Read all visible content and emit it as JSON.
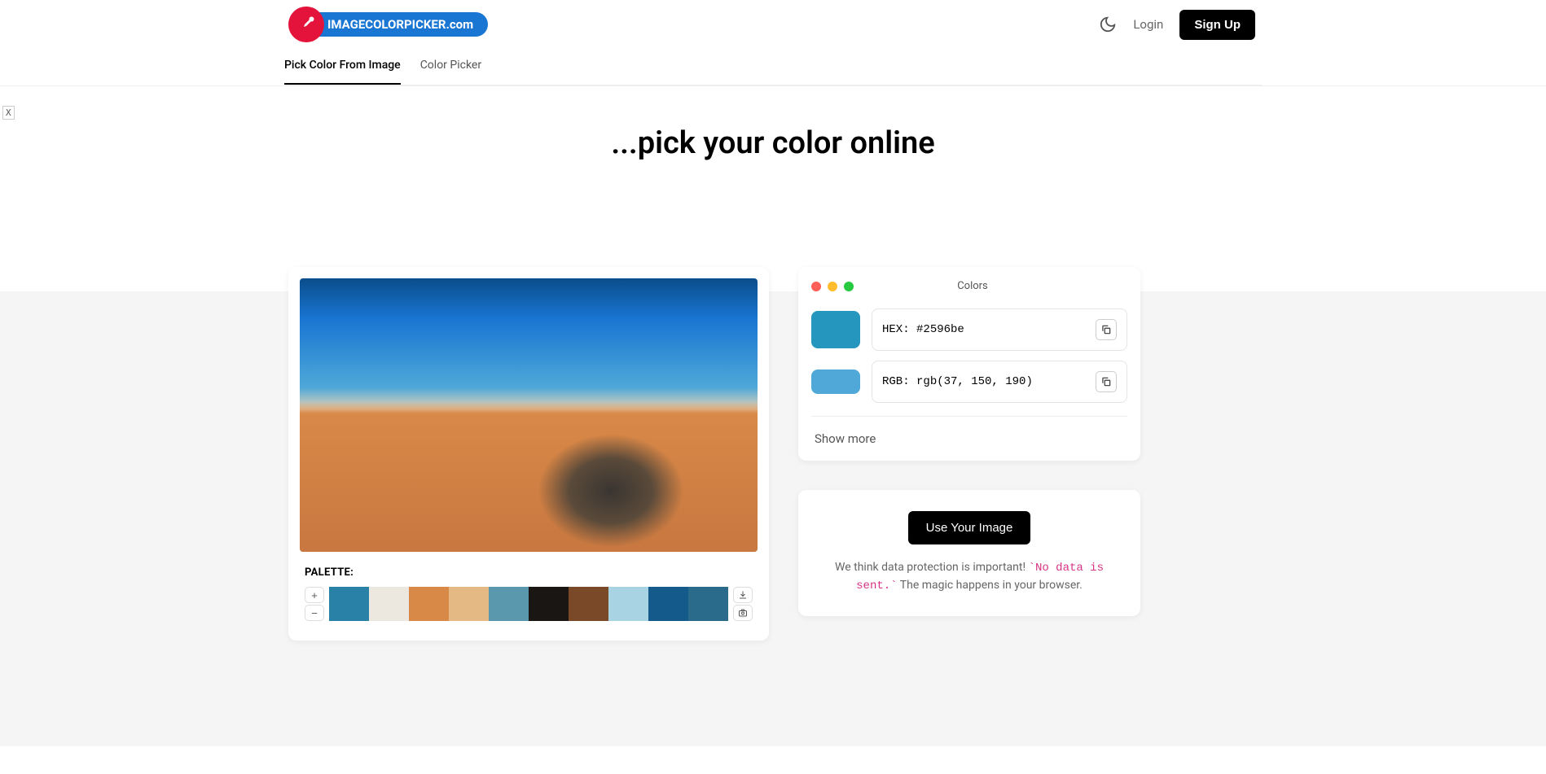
{
  "header": {
    "brand": "IMAGECOLORPICKER.com",
    "login": "Login",
    "signup": "Sign Up"
  },
  "nav": {
    "tabs": [
      {
        "label": "Pick Color From Image",
        "active": true
      },
      {
        "label": "Color Picker",
        "active": false
      }
    ]
  },
  "closeX": "X",
  "hero": {
    "title": "...pick your color online"
  },
  "colors_card": {
    "title": "Colors",
    "hex_label": "HEX:",
    "hex_value": "#2596be",
    "rgb_label": "RGB:",
    "rgb_value": "rgb(37, 150, 190)",
    "show_more": "Show more",
    "preview_hex": "#2596be",
    "preview_rgb": "#4fa8d8"
  },
  "palette": {
    "label": "PALETTE:",
    "plus": "+",
    "minus": "−",
    "swatches": [
      "#2a81a8",
      "#ede8df",
      "#d88847",
      "#e5b984",
      "#5a98ae",
      "#1a1614",
      "#7a4a28",
      "#a8d3e3",
      "#145a8a",
      "#2a6a8a"
    ]
  },
  "upload": {
    "button": "Use Your Image",
    "text1": "We think data protection is important! ",
    "code": "`No data is sent.`",
    "text2": " The magic happens in your browser."
  }
}
